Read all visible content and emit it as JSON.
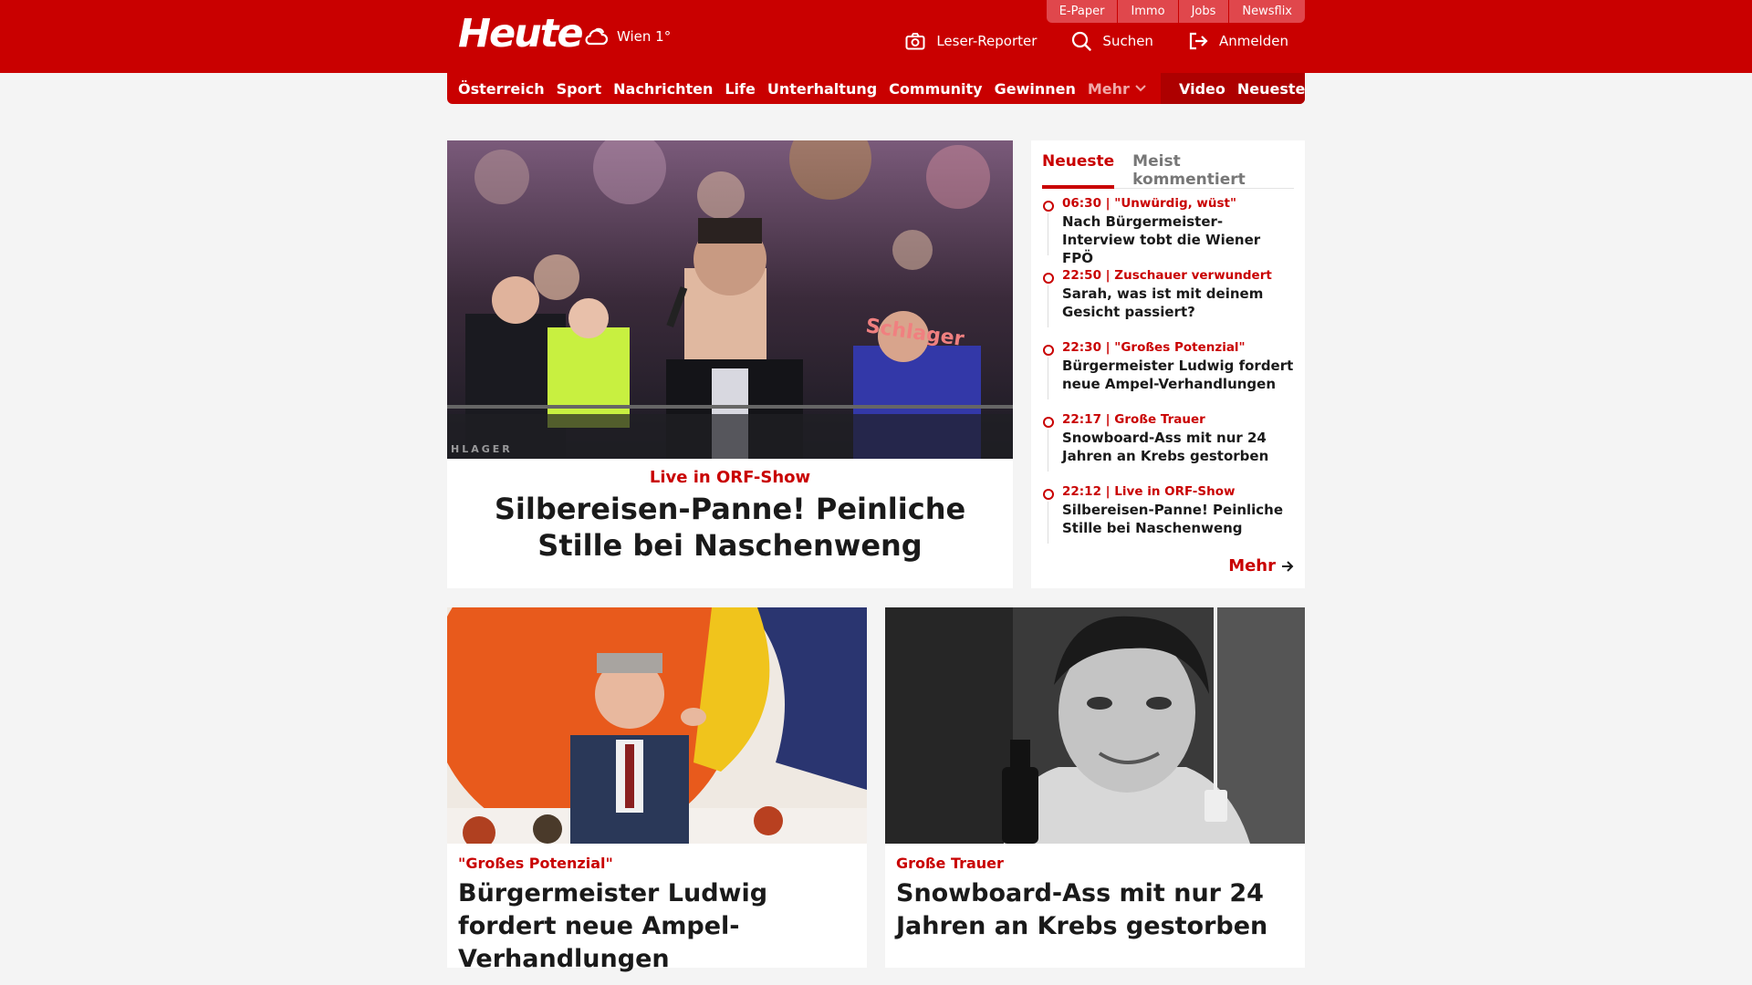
{
  "header": {
    "logo": "Heute",
    "weather": "Wien 1°",
    "topbar": [
      "E-Paper",
      "Immo",
      "Jobs",
      "Newsflix"
    ],
    "actions": {
      "reporter": "Leser-Reporter",
      "search": "Suchen",
      "login": "Anmelden"
    }
  },
  "nav": {
    "items": [
      "Österreich",
      "Sport",
      "Nachrichten",
      "Life",
      "Unterhaltung",
      "Community",
      "Gewinnen"
    ],
    "more": "Mehr",
    "right": [
      "Video",
      "Neueste"
    ]
  },
  "hero": {
    "image_label": "HLAGER",
    "kicker": "Live in ORF-Show",
    "headline": "Silbereisen-Panne! Peinliche Stille bei Naschenweng"
  },
  "sidebar": {
    "tabs": [
      "Neueste",
      "Meist kommentiert"
    ],
    "items": [
      {
        "meta": "06:30 | \"Unwürdig, wüst\"",
        "title": "Nach Bürgermeister-Interview tobt die Wiener FPÖ"
      },
      {
        "meta": "22:50 | Zuschauer verwundert",
        "title": "Sarah, was ist mit deinem Gesicht passiert?"
      },
      {
        "meta": "22:30 | \"Großes Potenzial\"",
        "title": "Bürgermeister Ludwig fordert neue Ampel-Verhandlungen"
      },
      {
        "meta": "22:17 | Große Trauer",
        "title": "Snowboard-Ass mit nur 24 Jahren an Krebs gestorben"
      },
      {
        "meta": "22:12 | Live in ORF-Show",
        "title": "Silbereisen-Panne! Peinliche Stille bei Naschenweng"
      }
    ],
    "more": "Mehr"
  },
  "cards": [
    {
      "kicker": "\"Großes Potenzial\"",
      "headline": "Bürgermeister Ludwig fordert neue Ampel-Verhandlungen"
    },
    {
      "kicker": "Große Trauer",
      "headline": "Snowboard-Ass mit nur 24 Jahren an Krebs gestorben"
    }
  ],
  "colors": {
    "brand": "#c90000",
    "nav_dark": "#ad0000",
    "background": "#f4f4f4"
  }
}
